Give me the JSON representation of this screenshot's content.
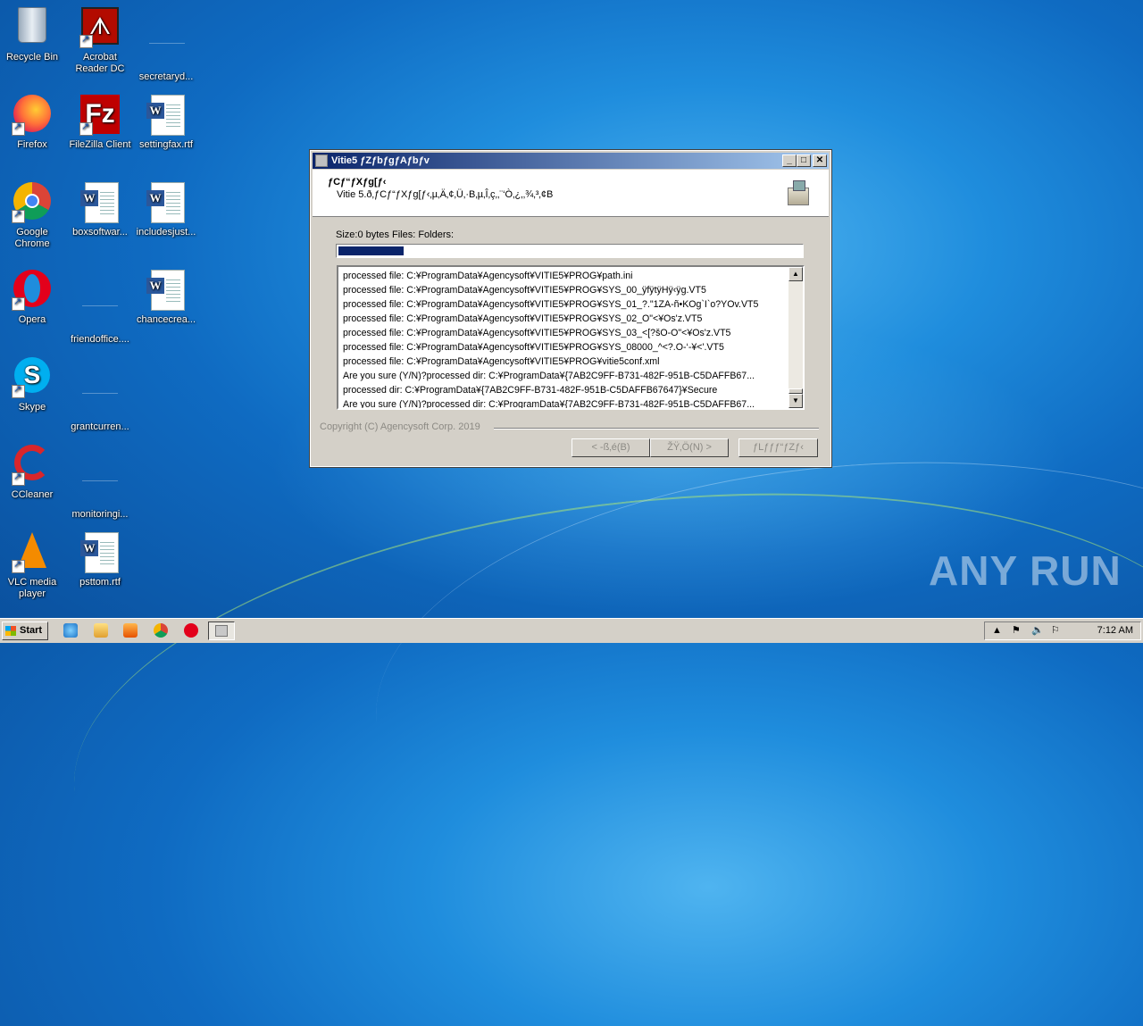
{
  "desktop": {
    "icons": [
      {
        "label": "Recycle Bin"
      },
      {
        "label": "Acrobat Reader DC"
      },
      {
        "label": "secretaryd..."
      },
      {
        "label": "Firefox"
      },
      {
        "label": "FileZilla Client"
      },
      {
        "label": "settingfax.rtf"
      },
      {
        "label": "Google Chrome"
      },
      {
        "label": "boxsoftwar..."
      },
      {
        "label": "includesjust..."
      },
      {
        "label": "Opera"
      },
      {
        "label": "friendoffice...."
      },
      {
        "label": "chancecrea..."
      },
      {
        "label": "Skype"
      },
      {
        "label": "grantcurren..."
      },
      {
        "label": "CCleaner"
      },
      {
        "label": "monitoringi..."
      },
      {
        "label": "VLC media player"
      },
      {
        "label": "psttom.rtf"
      }
    ]
  },
  "dialog": {
    "title": "Vitie5 ƒZƒbƒgƒAƒbƒv",
    "header_title": "ƒCƒ“ƒXƒg[ƒ‹",
    "header_subtitle": "Vitie 5.ð‚ƒCƒ“ƒXƒg[ƒ‹‚µ‚Ä‚¢‚Ü‚·B‚µ‚Î‚ç‚­‚¨‘Ò‚¿‚­‚¾‚³‚¢B",
    "status": "Size:0 bytes   Files:   Folders:",
    "progress": 0.14,
    "log_lines": [
      "processed file: C:¥ProgramData¥Agencysoft¥VITIE5¥PROG¥path.ini",
      "processed file: C:¥ProgramData¥Agencysoft¥VITIE5¥PROG¥SYS_00_ÿfÿtÿHÿ‹ÿg.VT5",
      "processed file: C:¥ProgramData¥Agencysoft¥VITIE5¥PROG¥SYS_01_?.\"1ZA-ñ•KOg`I`o?YOv.VT5",
      "processed file: C:¥ProgramData¥Agencysoft¥VITIE5¥PROG¥SYS_02_O\"<¥Os'z.VT5",
      "processed file: C:¥ProgramData¥Agencysoft¥VITIE5¥PROG¥SYS_03_<[?šO-O\"<¥Os'z.VT5",
      "processed file: C:¥ProgramData¥Agencysoft¥VITIE5¥PROG¥SYS_08000_^<?.O-‘-¥<'.VT5",
      "processed file: C:¥ProgramData¥Agencysoft¥VITIE5¥PROG¥vitie5conf.xml",
      "Are you sure (Y/N)?processed dir: C:¥ProgramData¥{7AB2C9FF-B731-482F-951B-C5DAFFB67...",
      "processed dir: C:¥ProgramData¥{7AB2C9FF-B731-482F-951B-C5DAFFB67647}¥Secure",
      "Are you sure (Y/N)?processed dir: C:¥ProgramData¥{7AB2C9FF-B731-482F-951B-C5DAFFB67..."
    ],
    "copyright": "Copyright (C) Agencysoft Corp. 2019",
    "btn_back": "< -ß‚é(B)",
    "btn_next": "ŽŸ‚Ö(N) >",
    "btn_cancel": "ƒLƒƒƒ“ƒZƒ‹"
  },
  "taskbar": {
    "start_label": "Start",
    "clock": "7:12 AM"
  },
  "watermark": "ANY RUN"
}
